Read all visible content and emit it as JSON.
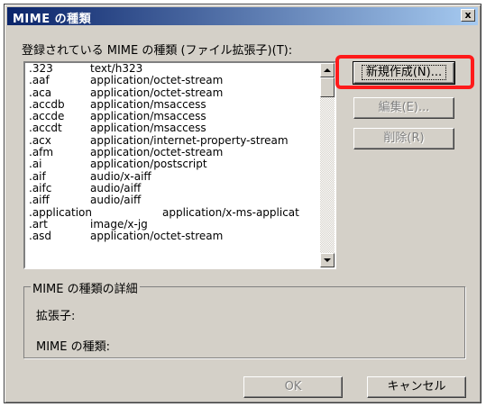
{
  "window": {
    "title": "MIME の種類",
    "close_label": "x"
  },
  "list": {
    "label": "登録されている MIME の種類 (ファイル拡張子)(T):",
    "rows": [
      {
        "ext": ".323",
        "mime": "text/h323",
        "wide": false
      },
      {
        "ext": ".aaf",
        "mime": "application/octet-stream",
        "wide": false
      },
      {
        "ext": ".aca",
        "mime": "application/octet-stream",
        "wide": false
      },
      {
        "ext": ".accdb",
        "mime": "application/msaccess",
        "wide": false
      },
      {
        "ext": ".accde",
        "mime": "application/msaccess",
        "wide": false
      },
      {
        "ext": ".accdt",
        "mime": "application/msaccess",
        "wide": false
      },
      {
        "ext": ".acx",
        "mime": "application/internet-property-stream",
        "wide": false
      },
      {
        "ext": ".afm",
        "mime": "application/octet-stream",
        "wide": false
      },
      {
        "ext": ".ai",
        "mime": "application/postscript",
        "wide": false
      },
      {
        "ext": ".aif",
        "mime": "audio/x-aiff",
        "wide": false
      },
      {
        "ext": ".aifc",
        "mime": "audio/aiff",
        "wide": false
      },
      {
        "ext": ".aiff",
        "mime": "audio/aiff",
        "wide": false
      },
      {
        "ext": ".application",
        "mime": "application/x-ms-applicat",
        "wide": true
      },
      {
        "ext": ".art",
        "mime": "image/x-jg",
        "wide": false
      },
      {
        "ext": ".asd",
        "mime": "application/octet-stream",
        "wide": false
      }
    ]
  },
  "buttons": {
    "new": "新規作成(N)...",
    "edit": "編集(E)...",
    "delete": "削除(R)",
    "ok": "OK",
    "cancel": "キャンセル"
  },
  "details": {
    "title": "MIME の種類の詳細",
    "extension_label": "拡張子:",
    "mime_label": "MIME の種類:"
  },
  "colors": {
    "highlight": "#ff1a1a",
    "titlebar": "#0a246a"
  }
}
